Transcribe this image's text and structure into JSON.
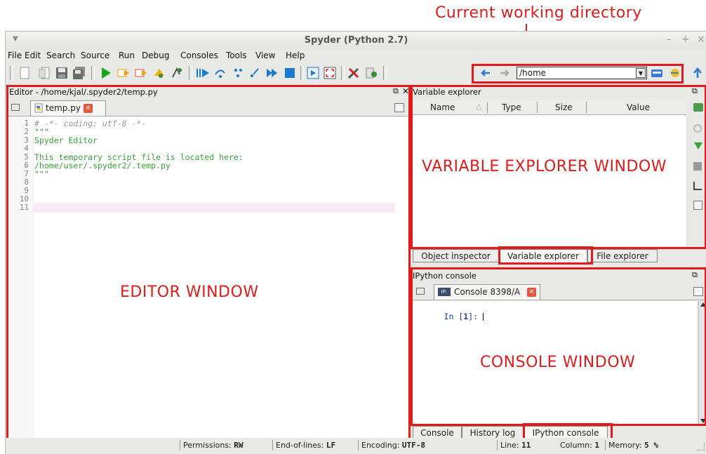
{
  "annotation_cwd": "Current working directory",
  "window": {
    "title": "Spyder (Python 2.7)",
    "controls": [
      "–",
      "+",
      "×"
    ]
  },
  "menu": [
    "File",
    "Edit",
    "Search",
    "Source",
    "Run",
    "Debug",
    "Consoles",
    "Tools",
    "View",
    "Help"
  ],
  "cwd": {
    "path": "/home"
  },
  "editor": {
    "header": "Editor - /home/kjal/.spyder2/temp.py",
    "tab": "temp.py",
    "line_numbers": [
      "1",
      "2",
      "3",
      "4",
      "5",
      "6",
      "7",
      "8",
      "9",
      "10",
      "11"
    ],
    "lines": [
      {
        "text": "# -*- coding: utf-8 -*-",
        "color": "#999999",
        "italic": true
      },
      {
        "text": "\"\"\"",
        "color": "#3aa33a"
      },
      {
        "text": "Spyder Editor",
        "color": "#3aa33a"
      },
      {
        "text": "",
        "color": "#3aa33a"
      },
      {
        "text": "This temporary script file is located here:",
        "color": "#3aa33a"
      },
      {
        "text": "/home/user/.spyder2/.temp.py",
        "color": "#3aa33a"
      },
      {
        "text": "\"\"\"",
        "color": "#3aa33a"
      },
      {
        "text": "",
        "color": "#3aa33a"
      },
      {
        "text": "",
        "color": "#3aa33a"
      },
      {
        "text": "",
        "color": "#3aa33a"
      },
      {
        "text": "",
        "color": "#3aa33a"
      }
    ],
    "label": "EDITOR WINDOW"
  },
  "varexp": {
    "header": "Variable explorer",
    "columns": [
      "Name",
      "Type",
      "Size",
      "Value"
    ],
    "label": "VARIABLE EXPLORER WINDOW",
    "tabs": [
      "Object inspector",
      "Variable explorer",
      "File explorer"
    ]
  },
  "console": {
    "header": "IPython console",
    "tab": "Console 8398/A",
    "prompt_in": "In [",
    "prompt_num": "1",
    "prompt_end": "]: ",
    "label": "CONSOLE WINDOW",
    "tabs": [
      "Console",
      "History log",
      "IPython console"
    ]
  },
  "statusbar": {
    "permissions_label": "Permissions:",
    "permissions_value": "RW",
    "eol_label": "End-of-lines:",
    "eol_value": "LF",
    "encoding_label": "Encoding:",
    "encoding_value": "UTF-8",
    "line_label": "Line:",
    "line_value": "11",
    "column_label": "Column:",
    "column_value": "1",
    "memory_label": "Memory:",
    "memory_value": "5 %"
  },
  "colors": {
    "annotation_red": "#e01b1b",
    "code_green": "#3aa33a",
    "prompt_blue": "#1e3ea8"
  }
}
